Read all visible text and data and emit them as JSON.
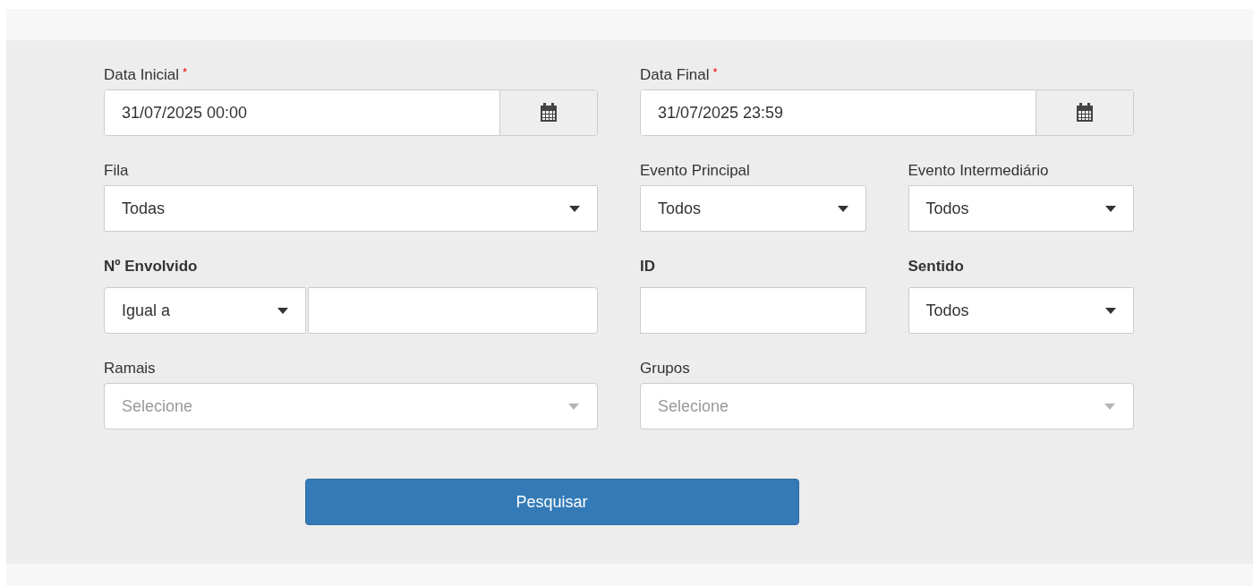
{
  "rows": [
    [
      {
        "kind": "date",
        "label": "Data Inicial",
        "required_mark": "*",
        "bold": false,
        "value": "31/07/2025 00:00"
      },
      {
        "kind": "date",
        "label": "Data Final",
        "required_mark": "*",
        "bold": false,
        "value": "31/07/2025 23:59"
      }
    ],
    [
      {
        "kind": "select",
        "label": "Fila",
        "bold": false,
        "value": "Todas"
      },
      {
        "kind": "select",
        "label": "Evento Principal",
        "bold": false,
        "value": "Todos"
      },
      {
        "kind": "select",
        "label": "Evento Intermediário",
        "bold": false,
        "value": "Todos"
      }
    ],
    [
      {
        "kind": "compound",
        "label": "Nº Envolvido",
        "bold": true,
        "operator": "Igual a"
      },
      {
        "kind": "text",
        "label": "ID",
        "bold": true
      },
      {
        "kind": "select",
        "label": "Sentido",
        "bold": true,
        "value": "Todos"
      }
    ],
    [
      {
        "kind": "multiselect",
        "label": "Ramais",
        "bold": false,
        "placeholder": "Selecione"
      },
      {
        "kind": "multiselect",
        "label": "Grupos",
        "bold": false,
        "placeholder": "Selecione"
      }
    ]
  ],
  "search_button": "Pesquisar"
}
